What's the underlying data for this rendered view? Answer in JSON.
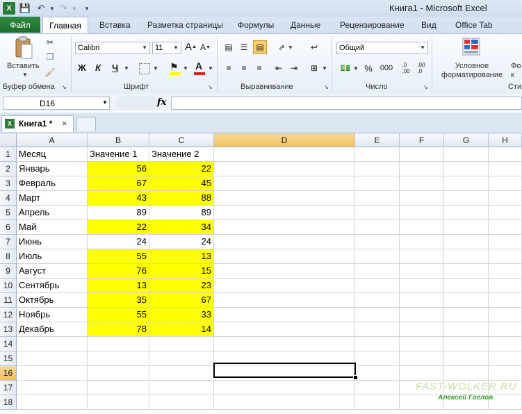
{
  "window": {
    "title": "Книга1  -  Microsoft Excel"
  },
  "ribbon_tabs": [
    "Файл",
    "Главная",
    "Вставка",
    "Разметка страницы",
    "Формулы",
    "Данные",
    "Рецензирование",
    "Вид",
    "Office Tab"
  ],
  "ribbon": {
    "clipboard": {
      "paste_label": "Вставить",
      "group_label": "Буфер обмена"
    },
    "font": {
      "family": "Calibri",
      "size": "11",
      "bold": "Ж",
      "italic": "К",
      "underline": "Ч",
      "grow": "A",
      "shrink": "A",
      "color_letter": "A",
      "group_label": "Шрифт"
    },
    "alignment": {
      "group_label": "Выравнивание"
    },
    "number": {
      "format": "Общий",
      "percent": "%",
      "thousands": "000",
      "inc_decimal": ",0\n,00",
      "dec_decimal": ",00\n,0",
      "group_label": "Число"
    },
    "styles": {
      "conditional_label": "Условное форматирование",
      "cut_label": "Фо\nк",
      "group_label": "Сти"
    }
  },
  "formula_bar": {
    "name_box": "D16",
    "fx": "fx",
    "value": ""
  },
  "workbook_tab": {
    "name": "Книга1 *",
    "close": "×"
  },
  "columns": [
    "A",
    "B",
    "C",
    "D",
    "E",
    "F",
    "G",
    "H"
  ],
  "rows": [
    [
      "Месяц",
      "Значение 1",
      "Значение 2"
    ],
    [
      "Январь",
      "56",
      "22"
    ],
    [
      "Февраль",
      "67",
      "45"
    ],
    [
      "Март",
      "43",
      "88"
    ],
    [
      "Апрель",
      "89",
      "89"
    ],
    [
      "Май",
      "22",
      "34"
    ],
    [
      "Июнь",
      "24",
      "24"
    ],
    [
      "Июль",
      "55",
      "13"
    ],
    [
      "Август",
      "76",
      "15"
    ],
    [
      "Сентябрь",
      "13",
      "23"
    ],
    [
      "Октябрь",
      "35",
      "67"
    ],
    [
      "Ноябрь",
      "55",
      "33"
    ],
    [
      "Декабрь",
      "78",
      "14"
    ],
    [
      "",
      "",
      ""
    ],
    [
      "",
      "",
      ""
    ],
    [
      "",
      "",
      ""
    ],
    [
      "",
      "",
      ""
    ],
    [
      "",
      "",
      ""
    ]
  ],
  "row_numbers": [
    "1",
    "2",
    "3",
    "4",
    "5",
    "6",
    "7",
    "8",
    "9",
    "10",
    "11",
    "12",
    "13",
    "14",
    "15",
    "16",
    "17",
    "18"
  ],
  "highlighted_rows": [
    2,
    3,
    4,
    6,
    8,
    9,
    10,
    11,
    12,
    13
  ],
  "selected_cell": "D16",
  "colors": {
    "highlight": "#ffff00",
    "file_tab": "#217a33"
  },
  "watermark": {
    "site": "FAST-WOLKER.RU",
    "author": "Алексей Гоглов"
  }
}
